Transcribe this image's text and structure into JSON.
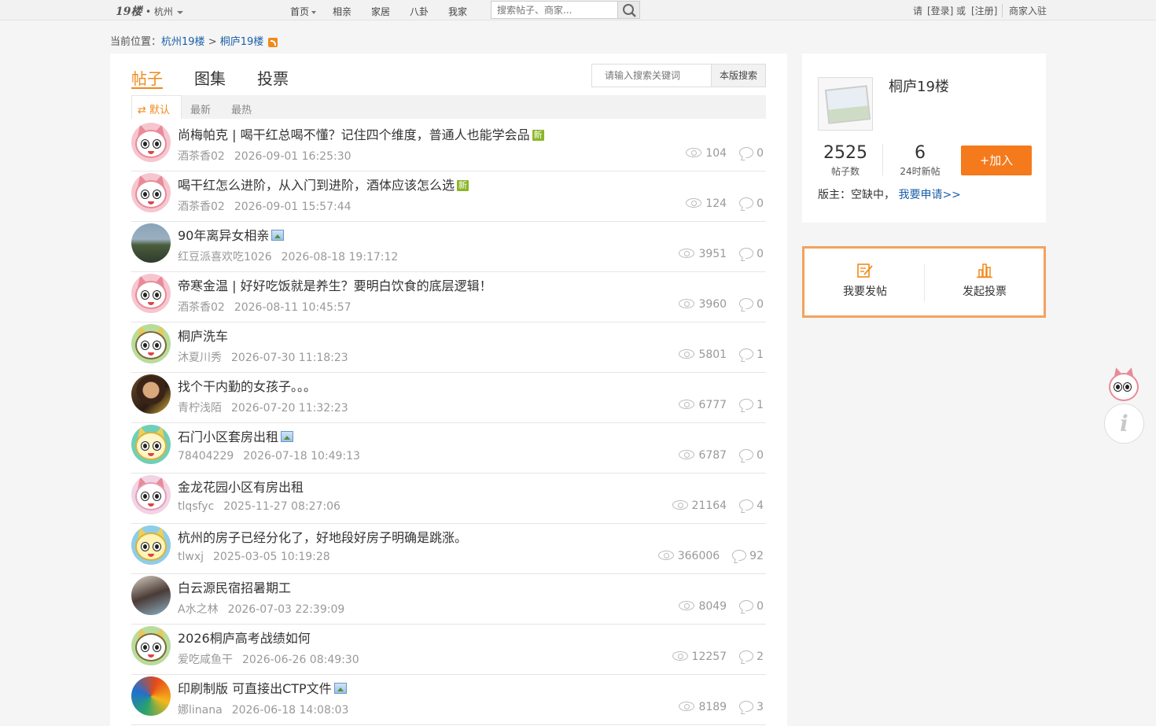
{
  "topbar": {
    "logo": "19楼",
    "city": "• 杭州",
    "nav": [
      {
        "label": "首页",
        "dropdown": true
      },
      {
        "label": "相亲",
        "dropdown": false
      },
      {
        "label": "家居",
        "dropdown": false
      },
      {
        "label": "八卦",
        "dropdown": false
      },
      {
        "label": "我家",
        "dropdown": false
      }
    ],
    "search_placeholder": "搜索帖子、商家...",
    "login_prefix": "请",
    "login": "[登录]",
    "or": "或",
    "register": "[注册]",
    "merchant": "商家入驻"
  },
  "breadcrumb": {
    "prefix": "当前位置：",
    "city_link": "杭州19楼",
    "sep": ">",
    "forum_link": "桐庐19楼"
  },
  "tabs": [
    {
      "label": "帖子",
      "active": true
    },
    {
      "label": "图集",
      "active": false
    },
    {
      "label": "投票",
      "active": false
    }
  ],
  "board_search": {
    "placeholder": "请输入搜索关键词",
    "button": "本版搜索"
  },
  "sort": {
    "default_icon": "⇄",
    "default": "默认",
    "newest": "最新",
    "hottest": "最热"
  },
  "posts": [
    {
      "title": "尚梅帕克 | 喝干红总喝不懂？记住四个维度，普通人也能学会品",
      "badge": "新",
      "pic": false,
      "author": "酒茶香02",
      "date": "2026-09-01 16:25:30",
      "views": "104",
      "replies": "0",
      "avatar": "pink-cat"
    },
    {
      "title": "喝干红怎么进阶，从入门到进阶，酒体应该怎么选",
      "badge": "新",
      "pic": false,
      "author": "酒茶香02",
      "date": "2026-09-01 15:57:44",
      "views": "124",
      "replies": "0",
      "avatar": "pink-cat"
    },
    {
      "title": "90年离异女相亲",
      "badge": "",
      "pic": true,
      "author": "红豆派喜欢吃1026",
      "date": "2026-08-18 19:17:12",
      "views": "3951",
      "replies": "0",
      "avatar": "scenery-photo"
    },
    {
      "title": "帝寒金温 | 好好吃饭就是养生？要明白饮食的底层逻辑！",
      "badge": "",
      "pic": false,
      "author": "酒茶香02",
      "date": "2026-08-11 10:45:57",
      "views": "3960",
      "replies": "0",
      "avatar": "pink-cat"
    },
    {
      "title": "桐庐洗车",
      "badge": "",
      "pic": false,
      "author": "沐夏川秀",
      "date": "2026-07-30 11:18:23",
      "views": "5801",
      "replies": "1",
      "avatar": "green-cat"
    },
    {
      "title": "找个干内勤的女孩子。。。",
      "badge": "",
      "pic": false,
      "author": "青柠浅陌",
      "date": "2026-07-20 11:32:23",
      "views": "6777",
      "replies": "1",
      "avatar": "girl-photo"
    },
    {
      "title": "石门小区套房出租",
      "badge": "",
      "pic": true,
      "author": "78404229",
      "date": "2026-07-18 10:49:13",
      "views": "6787",
      "replies": "0",
      "avatar": "teal-cat"
    },
    {
      "title": "金龙花园小区有房出租",
      "badge": "",
      "pic": false,
      "author": "tlqsfyc",
      "date": "2025-11-27 08:27:06",
      "views": "21164",
      "replies": "4",
      "avatar": "light-pink-cat"
    },
    {
      "title": "杭州的房子已经分化了，好地段好房子明确是跳涨。",
      "badge": "",
      "pic": false,
      "author": "tlwxj",
      "date": "2025-03-05 10:19:28",
      "views": "366006",
      "replies": "92",
      "avatar": "blue-cat"
    },
    {
      "title": "白云源民宿招暑期工",
      "badge": "",
      "pic": false,
      "author": "A水之林",
      "date": "2026-07-03 22:39:09",
      "views": "8049",
      "replies": "0",
      "avatar": "person-photo"
    },
    {
      "title": "2026桐庐高考战绩如何",
      "badge": "",
      "pic": false,
      "author": "爱吃咸鱼干",
      "date": "2026-06-26 08:49:30",
      "views": "12257",
      "replies": "2",
      "avatar": "green-cat"
    },
    {
      "title": "印刷制版 可直接出CTP文件",
      "badge": "",
      "pic": true,
      "author": "娜linana",
      "date": "2026-06-18 14:08:03",
      "views": "8189",
      "replies": "3",
      "avatar": "art-photo"
    }
  ],
  "sidebar": {
    "forum_name": "桐庐19楼",
    "posts_count": "2525",
    "posts_label": "帖子数",
    "new_24h": "6",
    "new_24h_label": "24时新帖",
    "join": "+加入",
    "moderator_label": "版主：空缺中，",
    "apply_link": "我要申请>>",
    "post_action": "我要发帖",
    "vote_action": "发起投票"
  },
  "colors": {
    "accent": "#f08a1c",
    "join_button": "#f47a1c",
    "link": "#1a5fa8",
    "new_badge": "#8bb52a"
  },
  "icons": [
    "dropdown-caret-icon",
    "search-icon",
    "rss-icon",
    "eye-icon",
    "comment-icon",
    "edit-icon",
    "bar-chart-icon",
    "info-icon"
  ]
}
